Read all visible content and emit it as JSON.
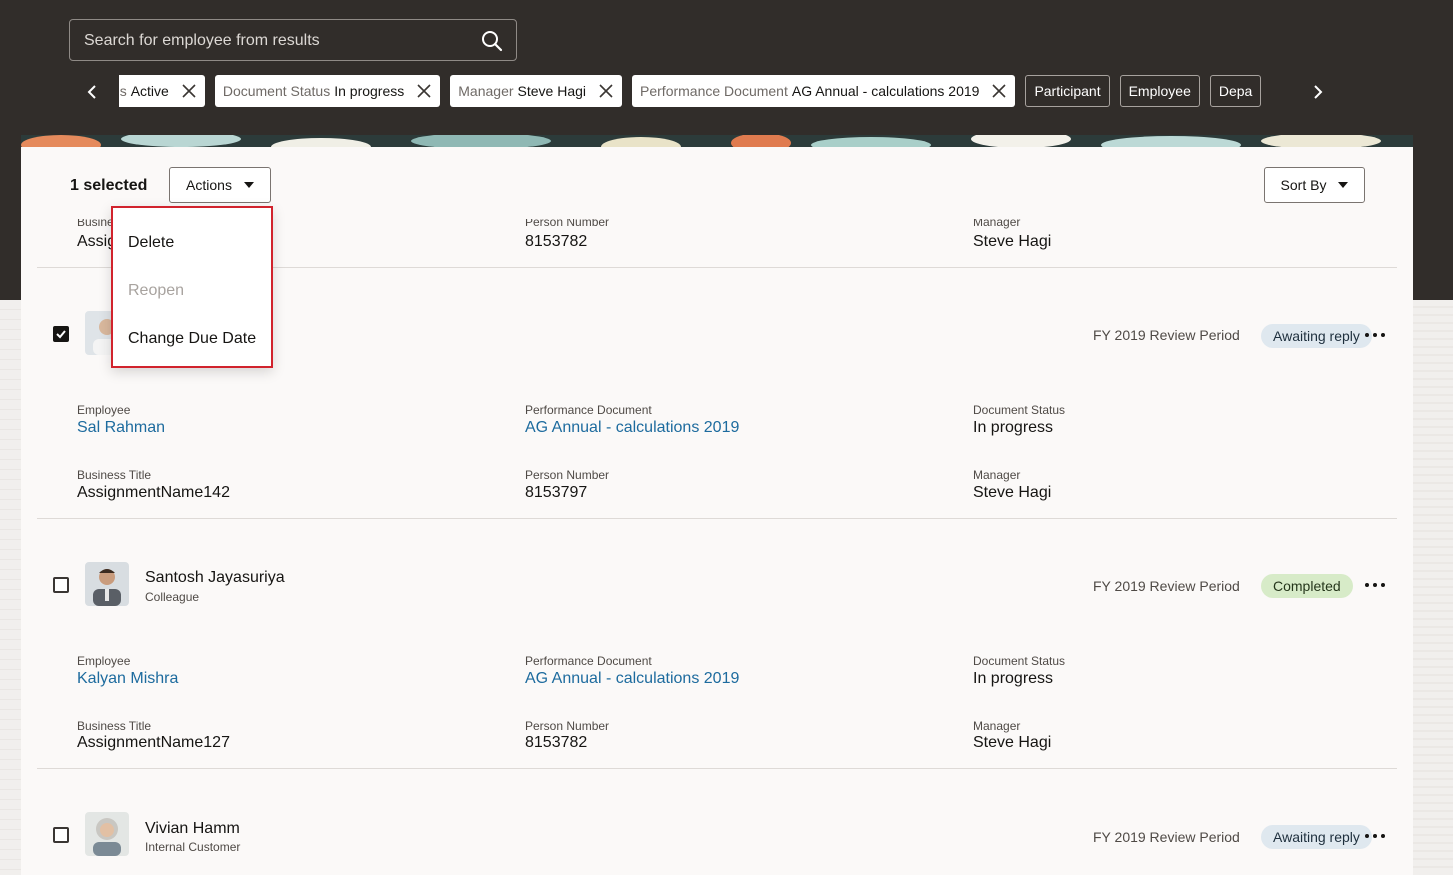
{
  "search": {
    "placeholder": "Search for employee from results"
  },
  "filters": {
    "chips": [
      {
        "key": "Status",
        "value": "Active",
        "visible_fragment": "us"
      },
      {
        "key": "Document Status",
        "value": "In progress"
      },
      {
        "key": "Manager",
        "value": "Steve Hagi"
      },
      {
        "key": "Performance Document",
        "value": "AG Annual - calculations 2019"
      }
    ],
    "outline_chips": [
      "Participant",
      "Employee",
      "Depa"
    ]
  },
  "toolbar": {
    "selected_text": "1 selected",
    "actions_label": "Actions",
    "sort_label": "Sort By"
  },
  "actions_menu": {
    "items": [
      {
        "label": "Delete",
        "enabled": true
      },
      {
        "label": "Reopen",
        "enabled": false
      },
      {
        "label": "Change Due Date",
        "enabled": true
      }
    ]
  },
  "labels": {
    "business": "Business Title",
    "business_cut": "Busine",
    "assign_cut": "Assig",
    "employee": "Employee",
    "performance_document": "Performance Document",
    "document_status": "Document Status",
    "business_title": "Business Title",
    "person_number": "Person Number",
    "manager": "Manager"
  },
  "partial_row": {
    "person_number": "8153782",
    "manager": "Steve Hagi"
  },
  "rows": [
    {
      "checked": true,
      "name": "",
      "role": "",
      "period": "FY 2019 Review Period",
      "status": "Awaiting reply",
      "employee": "Sal Rahman",
      "performance_document": "AG Annual - calculations 2019",
      "document_status": "In progress",
      "business_title": "AssignmentName142",
      "person_number": "8153797",
      "manager": "Steve Hagi"
    },
    {
      "checked": false,
      "name": "Santosh Jayasuriya",
      "role": "Colleague",
      "period": "FY 2019 Review Period",
      "status": "Completed",
      "employee": "Kalyan Mishra",
      "performance_document": "AG Annual - calculations 2019",
      "document_status": "In progress",
      "business_title": "AssignmentName127",
      "person_number": "8153782",
      "manager": "Steve Hagi"
    },
    {
      "checked": false,
      "name": "Vivian Hamm",
      "role": "Internal Customer",
      "period": "FY 2019 Review Period",
      "status": "Awaiting reply"
    }
  ]
}
